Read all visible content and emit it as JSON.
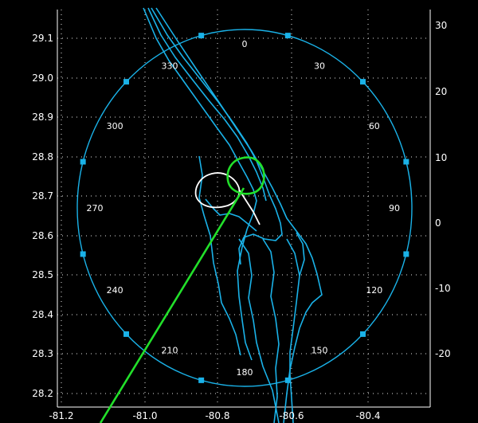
{
  "map": {
    "colors": {
      "background": "#000000",
      "grid": "#ffffff",
      "coastline": "#1ab2e8",
      "range_ring": "#1ab2e8",
      "track_line": "#22e02a",
      "green_contour": "#22e02a",
      "white_contour": "#ffffff"
    },
    "x_ticks": [
      "-81.2",
      "-81.0",
      "-80.8",
      "-80.6",
      "-80.4"
    ],
    "y_ticks_left": [
      "29.1",
      "29.0",
      "28.9",
      "28.8",
      "28.7",
      "28.6",
      "28.5",
      "28.4",
      "28.3",
      "28.2"
    ],
    "y_ticks_right": [
      "30",
      "20",
      "10",
      "0",
      "-10",
      "-20"
    ],
    "azimuth_labels": [
      "0",
      "30",
      "60",
      "90",
      "120",
      "150",
      "180",
      "210",
      "240",
      "270",
      "300",
      "330"
    ]
  }
}
